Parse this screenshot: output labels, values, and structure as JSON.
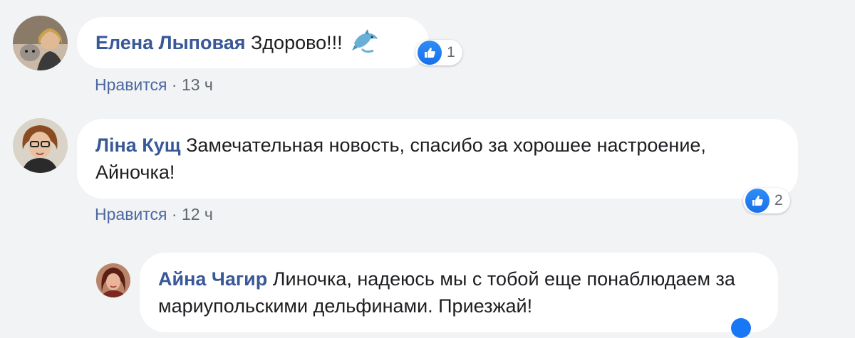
{
  "colors": {
    "background": "#f2f3f5",
    "bubble": "#ffffff",
    "author": "#385898",
    "meta": "#606770",
    "like_blue": "#1877f2"
  },
  "comments": [
    {
      "author": "Елена Лыповая",
      "text": "Здорово!!!",
      "emoji": "dolphin-emoji",
      "reaction_count": "1",
      "like_label": "Нравится",
      "separator": "·",
      "time": "13 ч"
    },
    {
      "author": "Ліна Кущ",
      "text": "Замечательная новость, спасибо за хорошее настроение, Айночка!",
      "reaction_count": "2",
      "like_label": "Нравится",
      "separator": "·",
      "time": "12 ч"
    },
    {
      "author": "Айна Чагир",
      "text": "Линочка, надеюсь мы с тобой еще понаблюдаем за мариупольскими дельфинами. Приезжай!"
    }
  ]
}
